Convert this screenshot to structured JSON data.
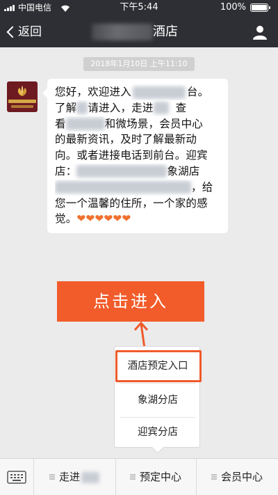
{
  "status_bar": {
    "carrier": "中国电信",
    "time": "下午5:44",
    "battery": "100%"
  },
  "nav": {
    "back_label": "返回",
    "title": "酒店"
  },
  "chat": {
    "timestamp": "2018年1月10日 上午11:10",
    "message_lines": [
      "您好，欢迎进入",
      "台。",
      "了解",
      "请进入，走进",
      "查",
      "看",
      "和微场景，会员中心",
      "的最新资讯，及时了解最新动",
      "向。或者进接电话到前台。迎宾",
      "店：",
      "象湖店",
      "，给",
      "您一个温馨的住所，一个家的感",
      "觉。"
    ],
    "hearts": "❤❤❤❤❤❤"
  },
  "cta": {
    "label": "点击进入"
  },
  "popup_menu": {
    "items": [
      "酒店预定入口",
      "象湖分店",
      "迎宾分店"
    ]
  },
  "bottom_menu": {
    "tabs": [
      "走进",
      "预定中心",
      "会员中心"
    ]
  },
  "colors": {
    "header_bg": "#2e2f34",
    "accent": "#f25c2a",
    "highlight": "#ef5a2a"
  }
}
